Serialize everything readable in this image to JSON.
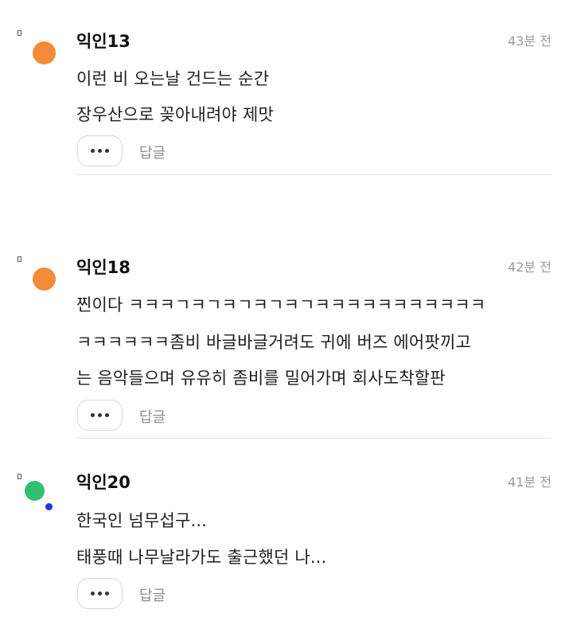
{
  "colors": {
    "avatar_orange": "#F28C38",
    "avatar_green": "#2FBF71",
    "avatar_dot_blue": "#2433E6",
    "timestamp": "#9A9A9A",
    "reply": "#8C8C8C"
  },
  "comments": [
    {
      "author": "익인13",
      "time": "43분 전",
      "lines": [
        "이런 비 오는날 건드는 순간",
        "장우산으로 꽂아내려야 제맛"
      ],
      "reply_label": "답글",
      "more_icon": "more-dots-icon"
    },
    {
      "author": "익인18",
      "time": "42분 전",
      "lines": [
        "찐이다 ㅋㅋㅋㄱㅋㄱㅋㄱㅋㄱㅋㄱㅋㅋㅋㅋㅋㅋㅋㅋㅋㅋㅋ",
        "ㅋㅋㅋㅋㅋㅋ좀비 바글바글거려도 귀에 버즈 에어팟끼고",
        "는 음악들으며 유유히 좀비를 밀어가며 회사도착할판"
      ],
      "reply_label": "답글",
      "more_icon": "more-dots-icon"
    },
    {
      "author": "익인20",
      "time": "41분 전",
      "lines": [
        "한국인 넘무섭구...",
        "태풍때 나무날라가도 출근했던 나..."
      ],
      "reply_label": "답글",
      "more_icon": "more-dots-icon"
    }
  ]
}
